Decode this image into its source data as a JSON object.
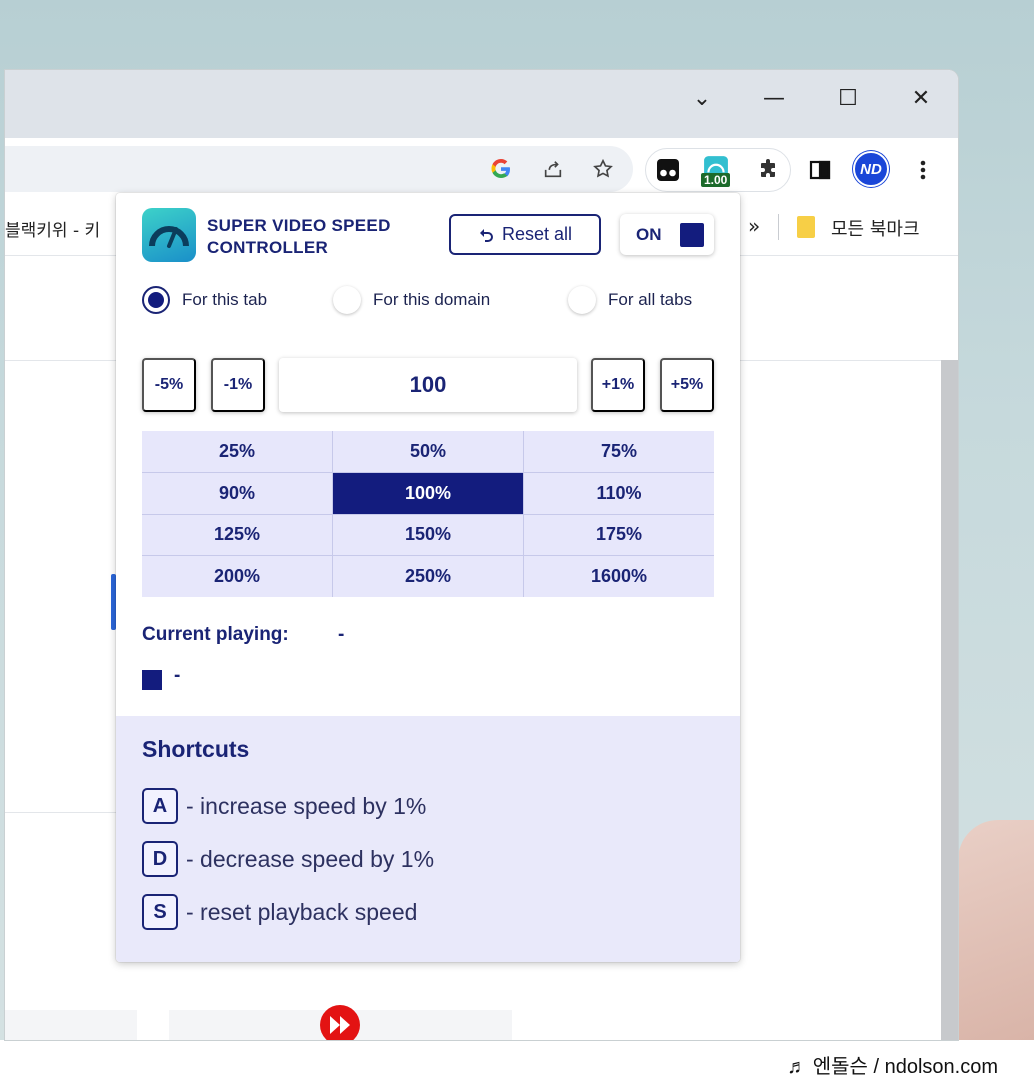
{
  "window": {
    "controls": {
      "dropdown": "⌄",
      "minimize": "—",
      "maximize": "☐",
      "close": "✕"
    }
  },
  "toolbar": {
    "extension_badge": "1.00",
    "profile_initials": "ND"
  },
  "bookmarks": {
    "left_partial": "블랙키위 - 키",
    "overflow": "»",
    "all_bookmarks": "모든 북마크"
  },
  "popup": {
    "brand_line1": "SUPER VIDEO SPEED",
    "brand_line2": "CONTROLLER",
    "reset_label": "Reset all",
    "toggle_label": "ON",
    "scope_options": [
      {
        "label": "For this tab",
        "checked": true
      },
      {
        "label": "For this domain",
        "checked": false
      },
      {
        "label": "For all tabs",
        "checked": false
      }
    ],
    "step_minus5": "-5%",
    "step_minus1": "-1%",
    "speed_value": "100",
    "step_plus1": "+1%",
    "step_plus5": "+5%",
    "presets": [
      "25%",
      "50%",
      "75%",
      "90%",
      "100%",
      "110%",
      "125%",
      "150%",
      "175%",
      "200%",
      "250%",
      "1600%"
    ],
    "active_preset": "100%",
    "current_label": "Current playing:",
    "current_value": "-",
    "swatch_value": "-",
    "shortcuts_title": "Shortcuts",
    "shortcuts": [
      {
        "key": "A",
        "desc": "- increase speed by 1%"
      },
      {
        "key": "D",
        "desc": "- decrease speed by 1%"
      },
      {
        "key": "S",
        "desc": "- reset playback speed"
      }
    ]
  },
  "watermark": "♬ 엔돌슨 / ndolson.com",
  "colors": {
    "accent": "#131c7e",
    "grid_bg": "#e7e7fb",
    "shortcut_bg": "#e9e9fa"
  }
}
